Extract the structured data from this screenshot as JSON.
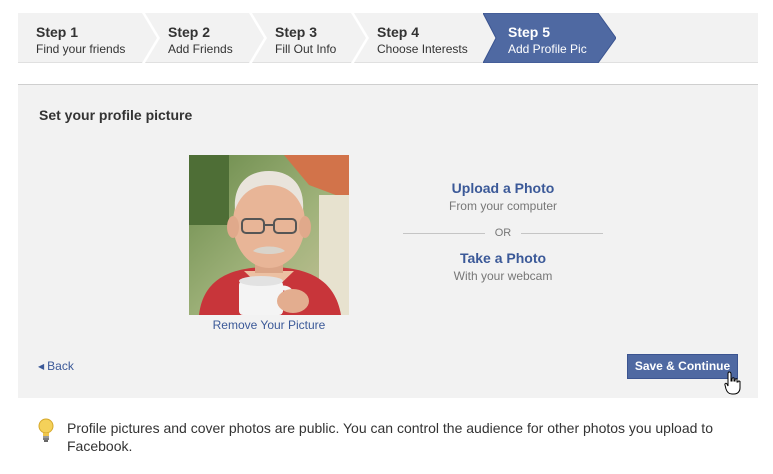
{
  "steps": [
    {
      "num": "Step 1",
      "label": "Find your friends"
    },
    {
      "num": "Step 2",
      "label": "Add Friends"
    },
    {
      "num": "Step 3",
      "label": "Fill Out Info"
    },
    {
      "num": "Step 4",
      "label": "Choose Interests"
    },
    {
      "num": "Step 5",
      "label": "Add Profile Pic"
    }
  ],
  "panel": {
    "title": "Set your profile picture",
    "remove_label": "Remove Your Picture",
    "upload": {
      "title": "Upload a Photo",
      "subtitle": "From your computer"
    },
    "or_label": "OR",
    "webcam": {
      "title": "Take a Photo",
      "subtitle": "With your webcam"
    },
    "back_label": "Back",
    "save_label": "Save & Continue"
  },
  "notice": {
    "text": "Profile pictures and cover photos are public. You can control the audience for other photos you upload to Facebook."
  },
  "colors": {
    "accent": "#3b5998",
    "active_step": "#4f69a2",
    "panel_bg": "#f2f2f2"
  },
  "icons": {
    "back": "caret-left-icon",
    "notice": "lightbulb-icon",
    "cursor": "hand-pointer-icon"
  }
}
